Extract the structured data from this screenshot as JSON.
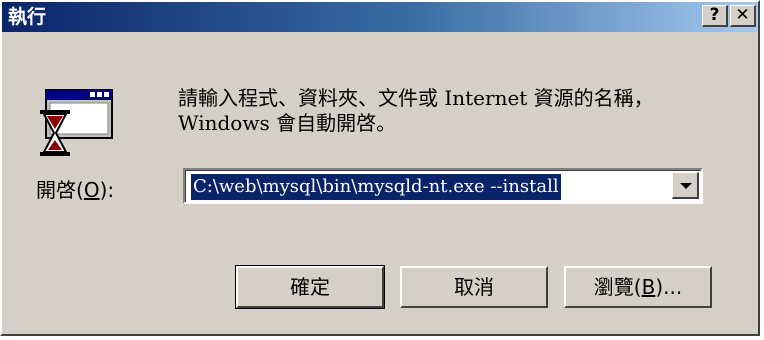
{
  "window": {
    "title": "執行",
    "help_glyph": "?",
    "close_glyph": "✕"
  },
  "message": "請輸入程式、資料夾、文件或 Internet 資源的名稱，\nWindows 會自動開啓。",
  "open_label_prefix": "開啓(",
  "open_label_key": "O",
  "open_label_suffix": "):",
  "command_value": "C:\\web\\mysql\\bin\\mysqld-nt.exe --install",
  "buttons": {
    "ok": "確定",
    "cancel": "取消",
    "browse_prefix": "瀏覽(",
    "browse_key": "B",
    "browse_suffix": ")..."
  },
  "colors": {
    "title_start": "#0a246a",
    "title_end": "#a6caf0",
    "face": "#d4d0c8",
    "selection": "#0a246a"
  },
  "icon": "run-program-hourglass-icon"
}
